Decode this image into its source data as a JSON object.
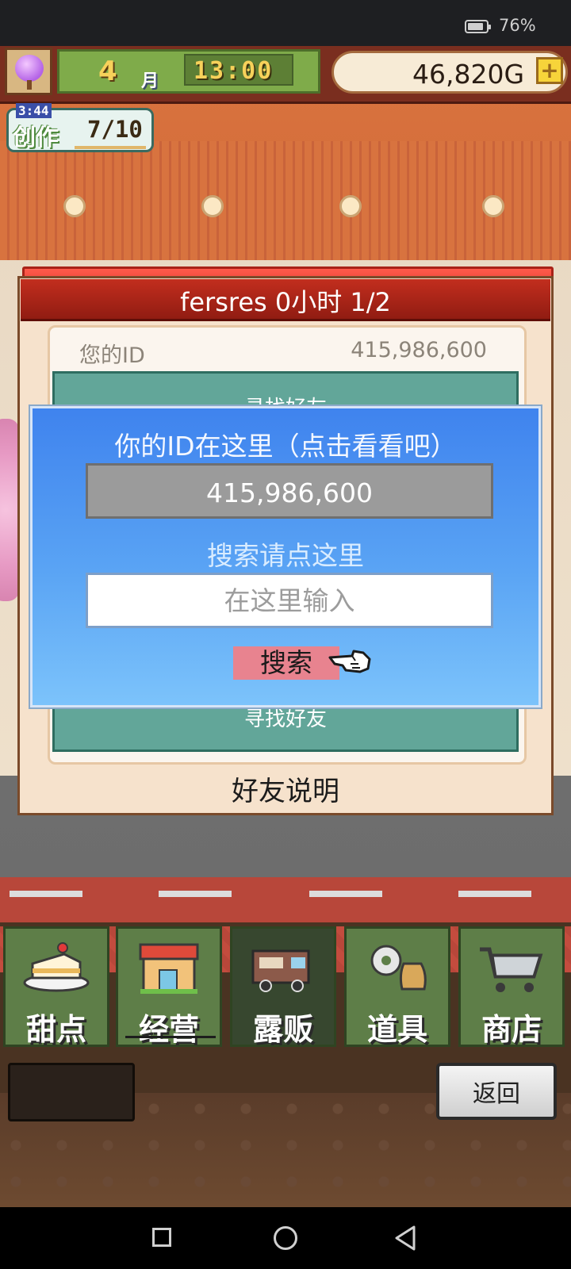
{
  "status_bar": {
    "battery_percent": "76%"
  },
  "hud": {
    "month_number": "4",
    "month_unit": "月",
    "time": "13:00",
    "gold": "46,820G",
    "add_gold": "+"
  },
  "create_badge": {
    "timer": "3:44",
    "label": "创作",
    "count": "7/10"
  },
  "friend_dialog": {
    "title": "fersres  0小时 1/2",
    "your_id_label": "您的ID",
    "your_id_value": "415,986,600",
    "find_friend_top": "寻找好友",
    "find_friend_bottom": "寻找好友",
    "guide": "好友说明"
  },
  "search_popup": {
    "title": "你的ID在这里（点击看看吧）",
    "id_value": "415,986,600",
    "search_hint": "搜索请点这里",
    "input_placeholder": "在这里输入",
    "search_button": "搜索"
  },
  "tabs": [
    {
      "label": "甜点",
      "icon": "cake-icon"
    },
    {
      "label": "经营",
      "icon": "shop-icon"
    },
    {
      "label": "露贩",
      "icon": "food-truck-icon",
      "active": true
    },
    {
      "label": "道具",
      "icon": "gear-bag-icon"
    },
    {
      "label": "商店",
      "icon": "cart-icon"
    }
  ],
  "back_button": "返回",
  "colors": {
    "popup_blue": "#3f83ee",
    "title_red": "#c22e1e",
    "search_button_pink": "#e8838f",
    "tab_green": "#5e7e48"
  }
}
